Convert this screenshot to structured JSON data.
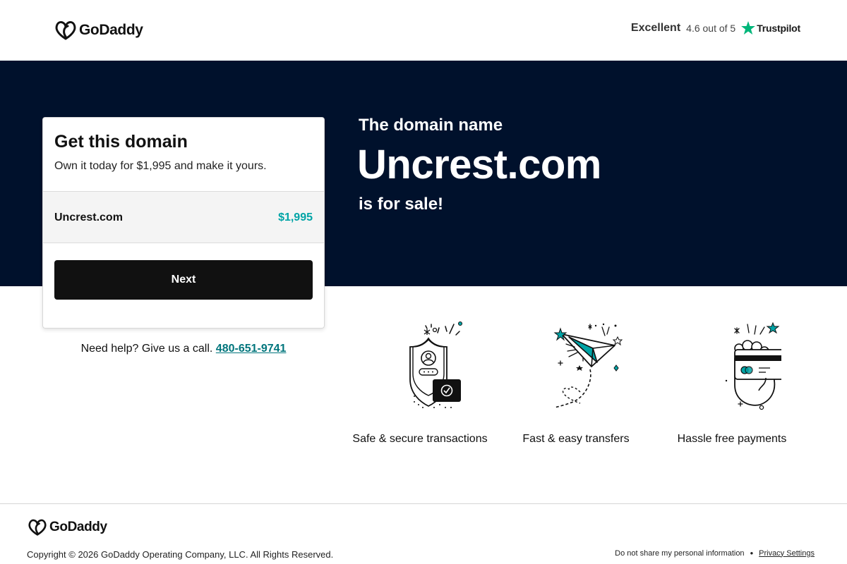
{
  "header": {
    "brand": "GoDaddy",
    "rating_word": "Excellent",
    "rating_score": "4.6 out of 5",
    "trustpilot": "Trustpilot"
  },
  "hero": {
    "eyebrow": "The domain name",
    "domain": "Uncrest.com",
    "sale": "is for sale!"
  },
  "card": {
    "title": "Get this domain",
    "subtitle": "Own it today for $1,995 and make it yours.",
    "row_domain": "Uncrest.com",
    "row_price": "$1,995",
    "next_label": "Next"
  },
  "help": {
    "text": "Need help? Give us a call.",
    "phone": "480-651-9741"
  },
  "features": [
    {
      "label": "Safe & secure transactions",
      "icon": "shield-icon"
    },
    {
      "label": "Fast & easy transfers",
      "icon": "paper-plane-icon"
    },
    {
      "label": "Hassle free payments",
      "icon": "card-in-hand-icon"
    }
  ],
  "footer": {
    "brand": "GoDaddy",
    "copyright": "Copyright © 2026 GoDaddy Operating Company, LLC. All Rights Reserved.",
    "do_not_share": "Do not share my personal information",
    "separator": "•",
    "privacy": "Privacy Settings"
  },
  "colors": {
    "hero_bg": "#00112c",
    "accent_teal": "#00a4a6",
    "phone_link": "#00757c",
    "button_bg": "#111111",
    "trustpilot_green": "#00b67a"
  }
}
